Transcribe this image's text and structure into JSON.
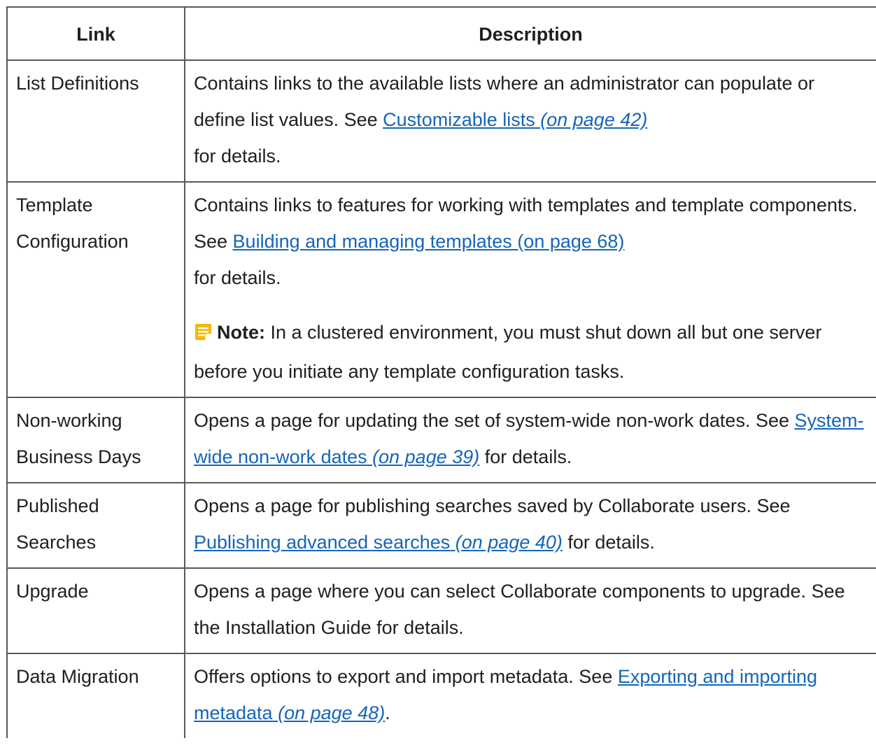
{
  "headers": {
    "link": "Link",
    "description": "Description"
  },
  "rows": {
    "r1": {
      "link": "List Definitions",
      "pre": "Contains links to the available lists where an administrator can populate or define list values. See ",
      "link_text": "Customizable lists",
      "page_ref": " (on page 42)",
      "post": " for details."
    },
    "r2": {
      "link": "Template Configuration",
      "pre": "Contains links to features for working with templates and template components. See ",
      "link_text": "Building and managing templates (on page 68)",
      "post": " for details.",
      "note_label": "Note:",
      "note_text": "  In a clustered environment, you must shut down all but one server before you initiate any template configuration tasks.",
      "note_icon": "note-icon",
      "note_icon_color": "#f5b800"
    },
    "r3": {
      "link": "Non-working Business Days",
      "pre": "Opens a page for updating the set of system-wide non-work dates. See ",
      "link_text": "System-wide non-work dates",
      "page_ref": " (on page 39)",
      "post": " for details."
    },
    "r4": {
      "link": "Published Searches",
      "pre": "Opens a page for publishing searches saved by Collaborate users. See ",
      "link_text": "Publishing advanced searches",
      "page_ref": " (on page 40)",
      "post": " for details."
    },
    "r5": {
      "link": "Upgrade",
      "text": "Opens a page where you can select Collaborate components to upgrade. See the Installation Guide for details."
    },
    "r6": {
      "link": "Data Migration",
      "pre": "Offers options to export and import metadata. See ",
      "link_text": "Exporting and importing metadata",
      "page_ref": " (on page 48)",
      "post": "."
    }
  },
  "colors": {
    "link": "#1565b8",
    "border": "#5a5a5a",
    "text": "#1f1f1f"
  }
}
